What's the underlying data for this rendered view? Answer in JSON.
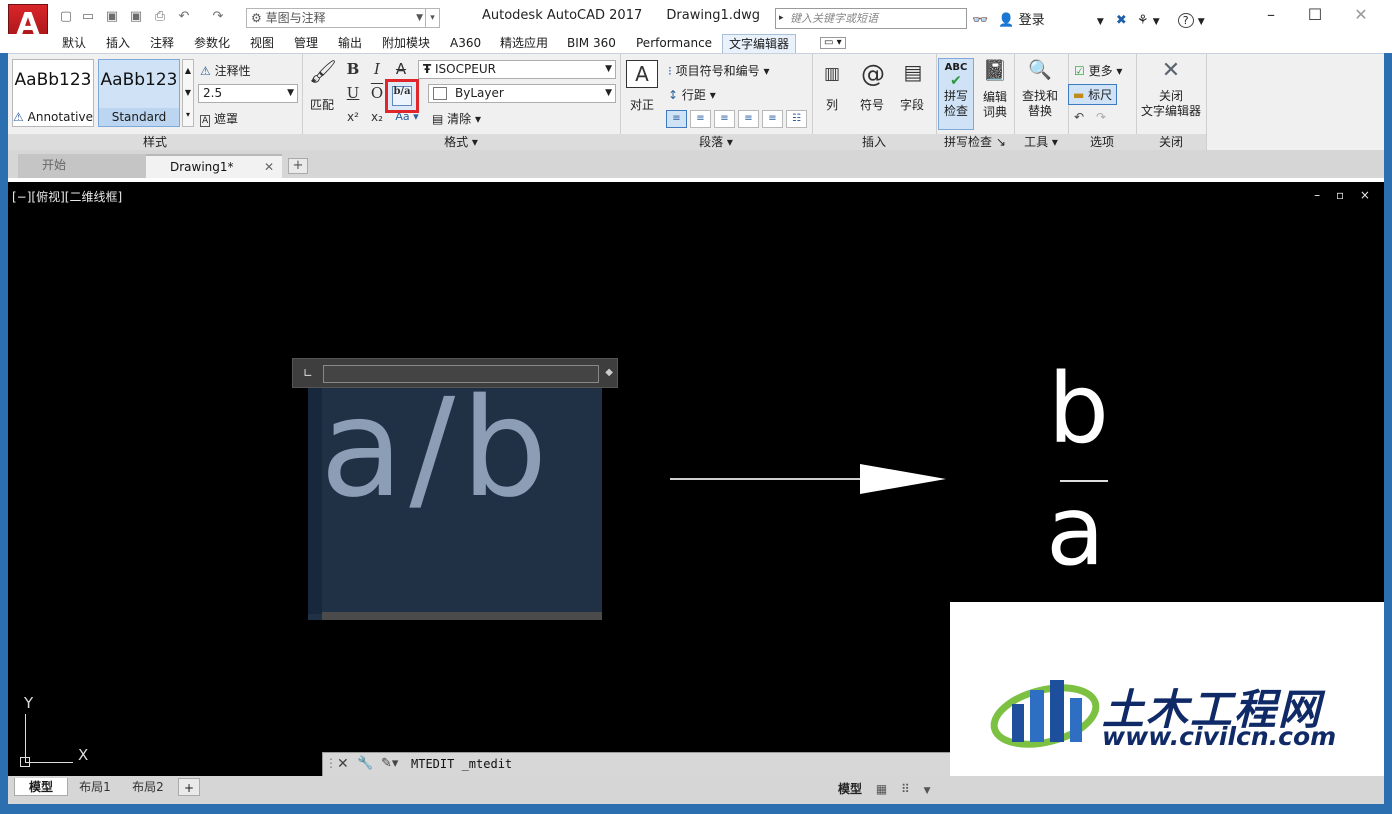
{
  "titlebar": {
    "app_name": "Autodesk AutoCAD 2017",
    "file_name": "Drawing1.dwg",
    "workspace": "草图与注释",
    "search_placeholder": "键入关键字或短语",
    "login": "登录",
    "help": "?",
    "logo_letter": "A"
  },
  "ribbon_tabs": [
    "默认",
    "插入",
    "注释",
    "参数化",
    "视图",
    "管理",
    "输出",
    "附加模块",
    "A360",
    "精选应用",
    "BIM 360",
    "Performance",
    "文字编辑器"
  ],
  "active_tab": "文字编辑器",
  "ribbon": {
    "style_panel": {
      "styles": [
        {
          "sample": "AaBb123",
          "name": "Annotative",
          "selected": false
        },
        {
          "sample": "AaBb123",
          "name": "Standard",
          "selected": true
        }
      ],
      "annotative_label": "注释性",
      "text_height": "2.5",
      "mask_label": "遮罩",
      "footer": "样式"
    },
    "format_panel": {
      "match_label": "匹配",
      "bold": "B",
      "italic": "I",
      "strike": "A",
      "underline": "U",
      "overline": "O",
      "stack": "b/a",
      "superscript": "x²",
      "subscript": "x₂",
      "case": "Aa",
      "font": "ISOCPEUR",
      "color": "ByLayer",
      "clear_label": "清除",
      "footer": "格式"
    },
    "paragraph_panel": {
      "justify_label": "对正",
      "bullets_label": "项目符号和编号",
      "line_spacing_label": "行距",
      "footer": "段落"
    },
    "insert_panel": {
      "columns_label": "列",
      "symbol_label": "符号",
      "field_label": "字段",
      "footer": "插入"
    },
    "spell_panel": {
      "spell_label": "拼写\n检查",
      "spell_line1": "拼写",
      "spell_line2": "检查",
      "dict_line1": "编辑",
      "dict_line2": "词典",
      "footer": "拼写检查"
    },
    "tools_panel": {
      "find_line1": "查找和",
      "find_line2": "替换",
      "footer": "工具"
    },
    "options_panel": {
      "more_label": "更多",
      "ruler_label": "标尺",
      "footer": "选项"
    },
    "close_panel": {
      "close_line1": "关闭",
      "close_line2": "文字编辑器",
      "footer": "关闭"
    }
  },
  "doc_tabs": [
    {
      "label": "开始",
      "active": false
    },
    {
      "label": "Drawing1*",
      "active": true
    }
  ],
  "viewport": {
    "label": "[−][俯视][二维线框]",
    "controls": "– ▫ ×"
  },
  "canvas": {
    "mtext": "a/b",
    "fraction_numerator": "b",
    "fraction_denominator": "a",
    "ucs_x": "X",
    "ucs_y": "Y"
  },
  "command_line": {
    "text": "MTEDIT _mtedit"
  },
  "watermark": {
    "cn": "土木工程网",
    "url": "www.civilcn.com"
  },
  "layout_tabs": [
    "模型",
    "布局1",
    "布局2"
  ],
  "status_bar": {
    "model_label": "模型"
  },
  "colors": {
    "accent_red": "#e0252b",
    "ribbon_bg": "#f0f0f0",
    "canvas_bg": "#000000",
    "mtext_highlight": "#203146"
  }
}
